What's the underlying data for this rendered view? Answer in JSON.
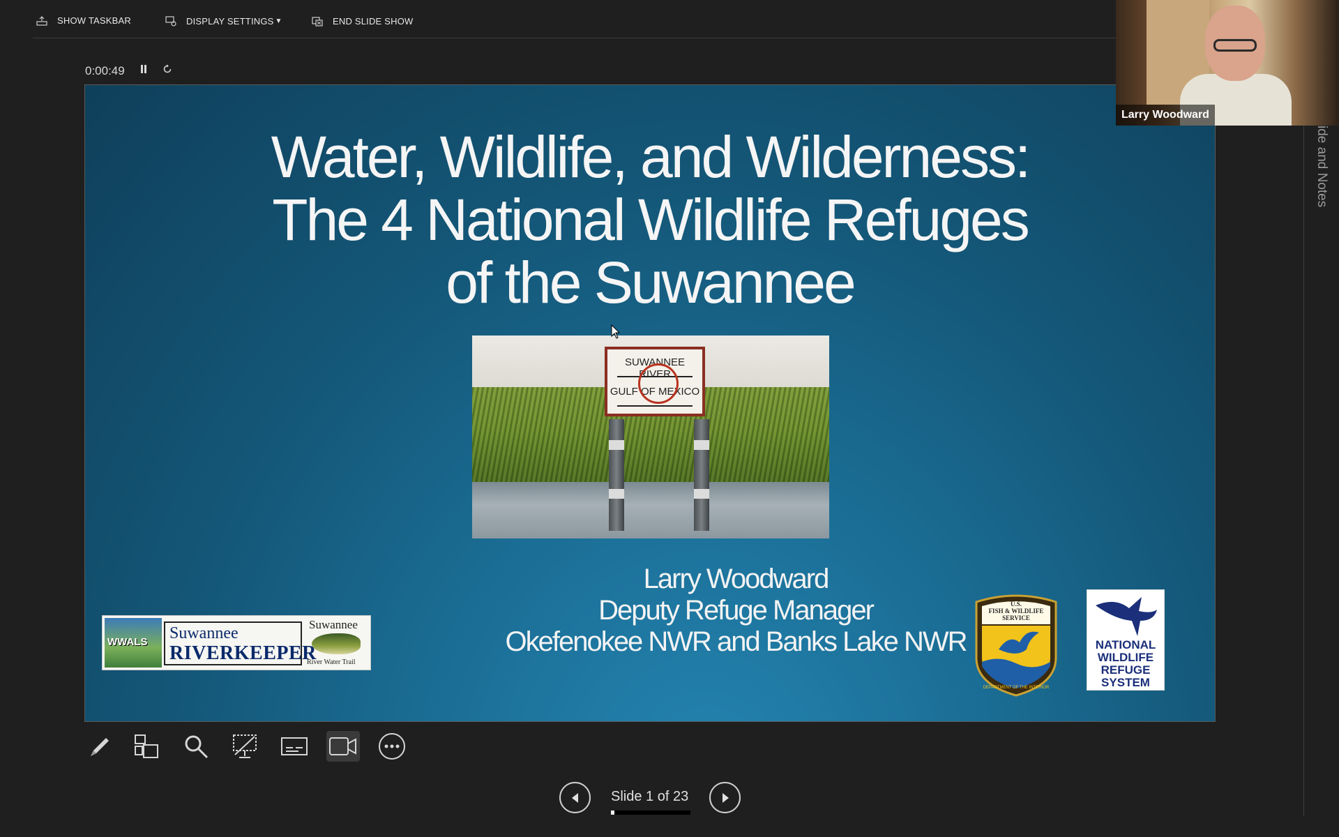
{
  "topbar": {
    "show_taskbar": "SHOW TASKBAR",
    "display_settings": "DISPLAY SETTINGS",
    "end_slide_show": "END SLIDE SHOW"
  },
  "timer": {
    "elapsed": "0:00:49",
    "pause_icon": "pause-icon",
    "restart_icon": "restart-icon"
  },
  "slide": {
    "title_lines": [
      "Water, Wildlife, and Wilderness:",
      "The 4 National Wildlife Refuges",
      "of the Suwannee"
    ],
    "photo_sign": [
      "SUWANNEE RIVER",
      "GULF OF MEXICO"
    ],
    "presenter_lines": [
      "Larry Woodward",
      "Deputy Refuge Manager",
      "Okefenokee NWR and Banks Lake NWR"
    ],
    "logo_left": {
      "wwals": "WWALS",
      "line1": "Suwannee",
      "line2": "RIVERKEEPER",
      "trail_line1": "Suwannee",
      "trail_line2": "River Water Trail"
    },
    "fws_badge": [
      "U.S.",
      "FISH & WILDLIFE",
      "SERVICE",
      "DEPARTMENT OF THE INTERIOR"
    ],
    "nwrs_logo": [
      "NATIONAL",
      "WILDLIFE",
      "REFUGE",
      "SYSTEM"
    ]
  },
  "toolbar": {
    "tools": [
      "pen-icon",
      "see-all-slides-icon",
      "zoom-icon",
      "black-screen-icon",
      "subtitles-icon",
      "camera-icon",
      "more-options-icon"
    ]
  },
  "navigation": {
    "counter": "Slide 1 of 23",
    "current": 1,
    "total": 23
  },
  "side_panel": {
    "label": "ide and Notes"
  },
  "webcam": {
    "name": "Larry Woodward"
  },
  "colors": {
    "background": "#1f1f1f",
    "slide_bg": "#145778",
    "nwrs_blue": "#1b2f7a",
    "fws_yellow": "#f2c31b"
  }
}
